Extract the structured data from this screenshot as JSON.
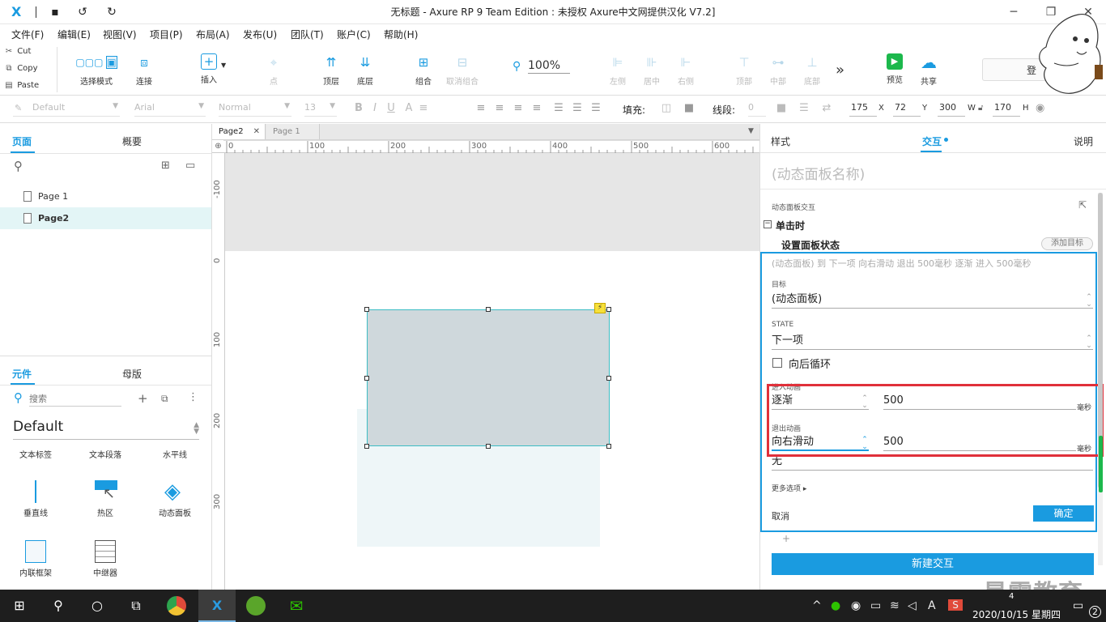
{
  "window": {
    "title": "无标题 - Axure RP 9 Team Edition : 未授权    Axure中文网提供汉化 V7.2]",
    "logo_text": "X",
    "quick_icons": [
      "save-icon",
      "undo-icon",
      "redo-icon"
    ],
    "controls": [
      "minimize",
      "maximize",
      "close"
    ]
  },
  "menu": [
    "文件(F)",
    "编辑(E)",
    "视图(V)",
    "项目(P)",
    "布局(A)",
    "发布(U)",
    "团队(T)",
    "账户(C)",
    "帮助(H)"
  ],
  "clipboard": {
    "cut": "Cut",
    "copy": "Copy",
    "paste": "Paste"
  },
  "toolbar": {
    "select_mode": "选择模式",
    "connect": "连接",
    "insert": "插入",
    "point": "点",
    "top_layer": "顶层",
    "bottom_layer": "底层",
    "group": "组合",
    "ungroup": "取消组合",
    "zoom": "100%",
    "align_left": "左侧",
    "align_center": "居中",
    "align_right": "右侧",
    "align_top": "顶部",
    "align_middle": "中部",
    "align_bottom": "底部",
    "more": "»",
    "preview": "预览",
    "share": "共享",
    "login": "登"
  },
  "format": {
    "style": "Default",
    "font": "Arial",
    "weight": "Normal",
    "size": "13",
    "fill_label": "填充:",
    "line_label": "线段:",
    "line_value": "0",
    "x": "175",
    "x_label": "X",
    "y": "72",
    "y_label": "Y",
    "w": "300",
    "w_label": "W",
    "h": "170",
    "h_label": "H"
  },
  "left": {
    "tab_pages": "页面",
    "tab_outline": "概要",
    "pages": [
      {
        "name": "Page 1",
        "selected": false
      },
      {
        "name": "Page2",
        "selected": true
      }
    ],
    "tab_widgets": "元件",
    "tab_masters": "母版",
    "search_placeholder": "搜索",
    "library": "Default",
    "widgets_row1": [
      "文本标签",
      "文本段落",
      "水平线"
    ],
    "widgets_row2": [
      "垂直线",
      "热区",
      "动态面板"
    ],
    "widgets_row3": [
      "内联框架",
      "中继器"
    ]
  },
  "canvas": {
    "tabs": [
      {
        "label": "Page2",
        "active": true
      },
      {
        "label": "Page 1",
        "active": false
      }
    ],
    "ruler_h": [
      "0",
      "100",
      "200",
      "300",
      "400",
      "500",
      "600"
    ],
    "ruler_v": [
      "-100",
      "0",
      "100",
      "200",
      "300"
    ]
  },
  "right": {
    "tab_style": "样式",
    "tab_interactions": "交互",
    "tab_notes": "说明",
    "name_placeholder": "(动态面板名称)",
    "section_title": "动态面板交互",
    "event": "单击时",
    "action": "设置面板状态",
    "add_target": "添加目标",
    "summary": "(动态面板) 到 下一项 向右滑动 退出 500毫秒 逐渐 进入 500毫秒",
    "target_label": "目标",
    "target_value": "(动态面板)",
    "state_label": "STATE",
    "state_value": "下一项",
    "wrap_label": "向后循环",
    "enter_label": "进入动画",
    "enter_anim": "逐渐",
    "enter_ms": "500",
    "exit_label": "退出动画",
    "exit_anim": "向右滑动",
    "exit_ms": "500",
    "ms_unit": "毫秒",
    "after_value": "无",
    "more_options": "更多选项",
    "cancel": "取消",
    "ok": "确定",
    "plus": "+",
    "new_interaction": "新建交互"
  },
  "watermark": "最需教育",
  "taskbar": {
    "clock_time": "4",
    "clock_date": "2020/10/15 星期四",
    "notification_count": "2",
    "ime": "A"
  },
  "colors": {
    "accent": "#1a9be0",
    "highlight": "#e0303a",
    "panel_fill": "#cfd8dc",
    "selection": "#3dbdc4"
  }
}
